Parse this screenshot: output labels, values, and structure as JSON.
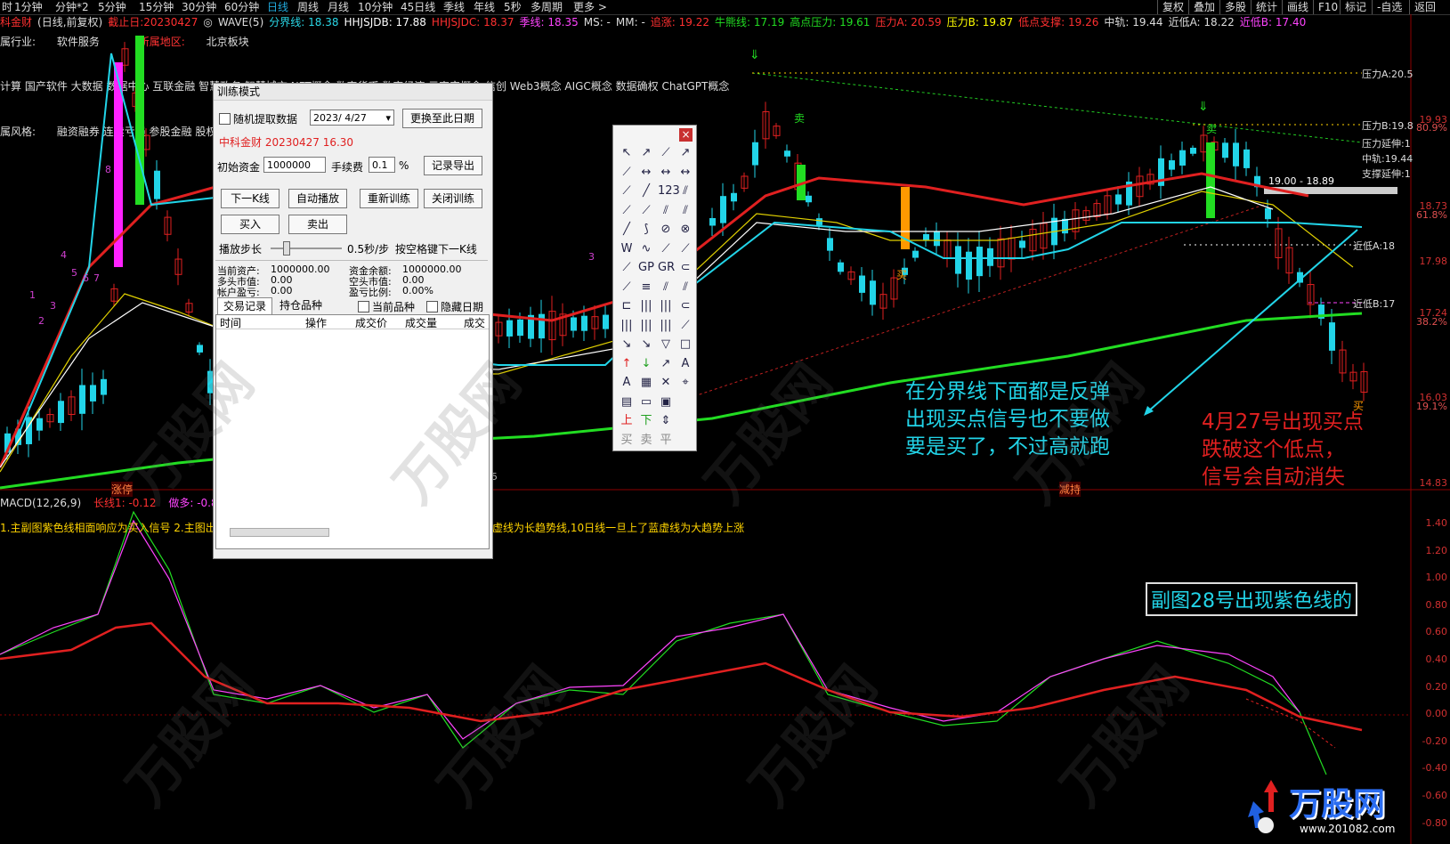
{
  "topbar": {
    "periods": [
      "时",
      "1分钟",
      "分钟*2",
      "5分钟",
      "15分钟",
      "30分钟",
      "60分钟",
      "日线",
      "周线",
      "月线",
      "10分钟",
      "45日线",
      "季线",
      "年线",
      "5秒",
      "多周期",
      "更多 >"
    ],
    "active_period": "日线",
    "right_buttons": [
      "复权",
      "叠加",
      "多股",
      "统计",
      "画线",
      "F10",
      "标记",
      "-自选",
      "返回"
    ]
  },
  "indicator_bar": [
    {
      "text": "科金财",
      "color": "#ff3030"
    },
    {
      "text": "(日线,前复权)",
      "color": "#dddddd"
    },
    {
      "text": "截止日:20230427",
      "color": "#ff3030"
    },
    {
      "text": "◎",
      "color": "#dddddd"
    },
    {
      "text": "WAVE(5)",
      "color": "#dddddd"
    },
    {
      "text": "分界线: 18.38",
      "color": "#2ad8e8"
    },
    {
      "text": "HHJSJDB: 17.88",
      "color": "#ffffff"
    },
    {
      "text": "HHJSJDC: 18.37",
      "color": "#ff3030"
    },
    {
      "text": "季线: 18.35",
      "color": "#ff44ff"
    },
    {
      "text": "MS: -",
      "color": "#dddddd"
    },
    {
      "text": "MM: -",
      "color": "#dddddd"
    },
    {
      "text": "追涨: 19.22",
      "color": "#ff3030"
    },
    {
      "text": "牛熊线: 17.19",
      "color": "#22dd22"
    },
    {
      "text": "高点压力: 19.61",
      "color": "#22dd22"
    },
    {
      "text": "压力A: 20.59",
      "color": "#ff3030"
    },
    {
      "text": "压力B: 19.87",
      "color": "#ffff00"
    },
    {
      "text": "低点支撑: 19.26",
      "color": "#ff3030"
    },
    {
      "text": "中轨: 19.44",
      "color": "#dddddd"
    },
    {
      "text": "近低A: 18.22",
      "color": "#dddddd"
    },
    {
      "text": "近低B: 17.40",
      "color": "#ff44ff"
    }
  ],
  "info": {
    "industry_label": "属行业:",
    "industry_value": "软件服务",
    "region_label": "所属地区:",
    "region_value": "北京板块",
    "concepts": "计算 国产软件 大数据 数据中心 互联金融 智慧政务 智慧城市 NFT概念 数字货币 数字经济 元宇宙概念 信创 Web3概念 AIGC概念 数据确权 ChatGPT概念",
    "style_label": "属风格:",
    "style_value": "融资融券 连续亏损 参股金融 股权转让"
  },
  "price_labels": {
    "right_axis": [
      "19.93",
      "80.9%",
      "18.73",
      "61.8%",
      "17.98",
      "17.24",
      "38.2%",
      "16.03",
      "19.1%",
      "14.83"
    ],
    "line_labels": [
      {
        "text": "压力A:20.5",
        "color": "#ffff00"
      },
      {
        "text": "压力B:19.8",
        "color": "#ffff00"
      },
      {
        "text": "压力延伸:1",
        "color": "#ffff00"
      },
      {
        "text": "中轨:19.44",
        "color": "#ffff00"
      },
      {
        "text": "支撑延伸:1",
        "color": "#ffff00"
      },
      {
        "text": "近低A:18",
        "color": "#ffffff"
      },
      {
        "text": "近低B:17",
        "color": "#ff44ff"
      }
    ],
    "range_label": "19.00 - 18.89"
  },
  "wave_numbers": [
    "1",
    "2",
    "3",
    "4",
    "5",
    "6",
    "7",
    "8",
    "3"
  ],
  "chart_markers": {
    "sell1": "卖",
    "sell2": "卖",
    "buy1": "买",
    "buy2": "买",
    "limit_up": "涨停",
    "limit_down": "减持",
    "low_mark": "95"
  },
  "annotations": {
    "cyan_text": [
      "在分界线下面都是反弹",
      "出现买点信号也不要做",
      "要是买了，不过高就跑"
    ],
    "red_text": [
      "4月27号出现买点",
      "跌破这个低点，",
      "信号会自动消失"
    ],
    "boxed_text": "副图28号出现紫色线的"
  },
  "macd": {
    "title": "MACD(12,26,9)",
    "long_line": "长线1: -0.12",
    "short_line": "做多: -0.86",
    "trend_label": "做多",
    "desc": "1.主副图紫色线相面响应为买入信号 2.主图出现卖出信号要减仓 3.确认买入.撒开会加速下跌 4.主图蓝色虚线为长趋势线,10日线一旦上了蓝虚线为大趋势上涨",
    "axis": [
      "1.40",
      "1.20",
      "1.00",
      "0.80",
      "0.60",
      "0.40",
      "0.20",
      "0.00",
      "-0.20",
      "-0.40",
      "-0.60",
      "-0.80"
    ]
  },
  "dialog": {
    "title": "训练模式",
    "random_label": "随机提取数据",
    "date_value": "2023/ 4/27",
    "change_date_btn": "更换至此日期",
    "stock_info": "中科金财  20230427  16.30",
    "capital_label": "初始资金",
    "capital_value": "1000000",
    "fee_label": "手续费",
    "fee_value": "0.1",
    "fee_unit": "%",
    "export_btn": "记录导出",
    "next_k_btn": "下一K线",
    "auto_play_btn": "自动播放",
    "restart_btn": "重新训练",
    "close_btn": "关闭训练",
    "buy_btn": "买入",
    "sell_btn": "卖出",
    "step_label": "播放步长",
    "step_value": "0.5秒/步",
    "step_hint": "按空格键下一K线",
    "stats": [
      {
        "k": "当前资产:",
        "v": "1000000.00"
      },
      {
        "k": "资金余额:",
        "v": "1000000.00"
      },
      {
        "k": "多头市值:",
        "v": "0.00"
      },
      {
        "k": "空头市值:",
        "v": "0.00"
      },
      {
        "k": "帐户盈亏:",
        "v": "0.00"
      },
      {
        "k": "盈亏比例:",
        "v": "0.00%"
      }
    ],
    "tab_trades": "交易记录",
    "tab_holdings": "持仓品种",
    "current_label": "当前品种",
    "hide_date_label": "隐藏日期",
    "columns": [
      "时间",
      "操作",
      "成交价",
      "成交量",
      "成交"
    ]
  },
  "toolbox": {
    "close": "×",
    "tools": [
      "↖",
      "↗",
      "⟋",
      "↗",
      "⟋",
      "↔",
      "↔",
      "↔",
      "⟋",
      "╱",
      "123",
      "⫽",
      "⟋",
      "⟋",
      "⫽",
      "⫽",
      "╱",
      "⟆",
      "⊘",
      "⊗",
      "W",
      "∿",
      "⟋",
      "⟋",
      "⟋",
      "GP",
      "GR",
      "⊂",
      "⟋",
      "≡",
      "⫽",
      "⫽",
      "⊏",
      "|||",
      "|||",
      "⊂",
      "|||",
      "|||",
      "|||",
      "⟋",
      "↘",
      "↘",
      "▽",
      "□",
      "↑",
      "↓",
      "↗",
      "A",
      "A",
      "▦",
      "✕",
      "⌖",
      "▤",
      "▭",
      "▣",
      "",
      "上",
      "下",
      "⇕",
      "",
      "买",
      "卖",
      "平",
      ""
    ]
  },
  "logo": {
    "main": "万股网",
    "sub": "www.201082.com"
  },
  "watermark": "万股网"
}
